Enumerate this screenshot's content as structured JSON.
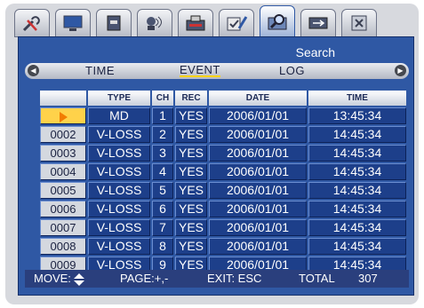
{
  "header": {
    "title": "Search"
  },
  "tabs": [
    {
      "icon": "tools-icon"
    },
    {
      "icon": "monitor-icon"
    },
    {
      "icon": "storage-icon"
    },
    {
      "icon": "camera-icon"
    },
    {
      "icon": "record-icon"
    },
    {
      "icon": "settings-icon"
    },
    {
      "icon": "search-icon",
      "active": true
    },
    {
      "icon": "network-icon"
    },
    {
      "icon": "close-icon"
    }
  ],
  "subnav": {
    "items": [
      "TIME",
      "EVENT",
      "LOG"
    ],
    "active": "EVENT"
  },
  "table": {
    "columns": [
      "",
      "TYPE",
      "CH",
      "REC",
      "DATE",
      "TIME"
    ],
    "rows": [
      {
        "no": "",
        "type": "MD",
        "ch": "1",
        "rec": "YES",
        "date": "2006/01/01",
        "time": "13:45:34",
        "selected": true
      },
      {
        "no": "0002",
        "type": "V-LOSS",
        "ch": "2",
        "rec": "YES",
        "date": "2006/01/01",
        "time": "14:45:34"
      },
      {
        "no": "0003",
        "type": "V-LOSS",
        "ch": "3",
        "rec": "YES",
        "date": "2006/01/01",
        "time": "14:45:34"
      },
      {
        "no": "0004",
        "type": "V-LOSS",
        "ch": "4",
        "rec": "YES",
        "date": "2006/01/01",
        "time": "14:45:34"
      },
      {
        "no": "0005",
        "type": "V-LOSS",
        "ch": "5",
        "rec": "YES",
        "date": "2006/01/01",
        "time": "14:45:34"
      },
      {
        "no": "0006",
        "type": "V-LOSS",
        "ch": "6",
        "rec": "YES",
        "date": "2006/01/01",
        "time": "14:45:34"
      },
      {
        "no": "0007",
        "type": "V-LOSS",
        "ch": "7",
        "rec": "YES",
        "date": "2006/01/01",
        "time": "14:45:34"
      },
      {
        "no": "0008",
        "type": "V-LOSS",
        "ch": "8",
        "rec": "YES",
        "date": "2006/01/01",
        "time": "14:45:34"
      },
      {
        "no": "0009",
        "type": "V-LOSS",
        "ch": "9",
        "rec": "YES",
        "date": "2006/01/01",
        "time": "14:45:34"
      }
    ]
  },
  "footer": {
    "move_label": "MOVE:",
    "page_label": "PAGE:+,-",
    "exit_label": "EXIT: ESC",
    "total_label": "TOTAL",
    "total_value": "307"
  },
  "colors": {
    "panel": "#2f58a4",
    "cell": "#1d3f8a",
    "selected_marker": "#f27d00"
  }
}
